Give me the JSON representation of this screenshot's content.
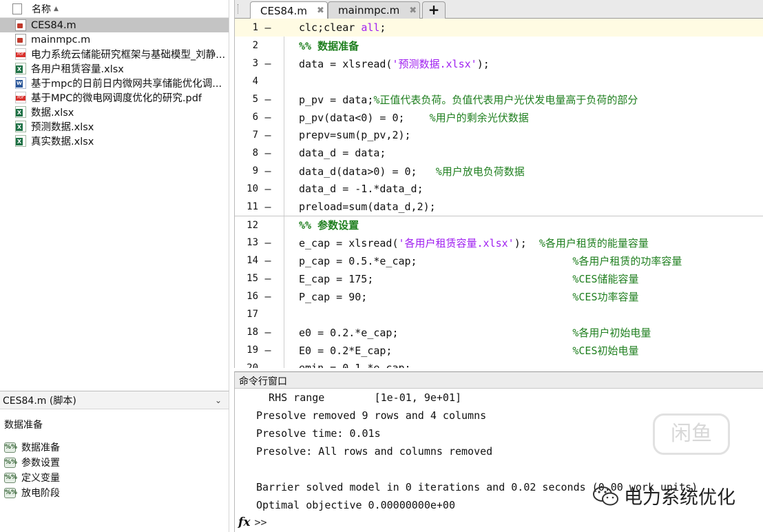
{
  "file_browser": {
    "column_header": "名称",
    "files": [
      {
        "name": "CES84.m",
        "type": "m",
        "selected": true
      },
      {
        "name": "mainmpc.m",
        "type": "m",
        "selected": false
      },
      {
        "name": "电力系统云储能研究框架与基础模型_刘静...",
        "type": "pdf",
        "selected": false
      },
      {
        "name": "各用户租赁容量.xlsx",
        "type": "xlsx",
        "selected": false
      },
      {
        "name": "基于mpc的日前日内微网共享储能优化调...",
        "type": "docx",
        "selected": false
      },
      {
        "name": "基于MPC的微电网调度优化的研究.pdf",
        "type": "pdf",
        "selected": false
      },
      {
        "name": "数据.xlsx",
        "type": "xlsx",
        "selected": false
      },
      {
        "name": "预测数据.xlsx",
        "type": "xlsx",
        "selected": false
      },
      {
        "name": "真实数据.xlsx",
        "type": "xlsx",
        "selected": false
      }
    ]
  },
  "details": {
    "header": "CES84.m (脚本)",
    "title": "数据准备",
    "sections": [
      "数据准备",
      "参数设置",
      "定义变量",
      "放电阶段"
    ],
    "section_icon": "%%"
  },
  "editor": {
    "tabs": [
      {
        "label": "CES84.m",
        "active": true
      },
      {
        "label": "mainmpc.m",
        "active": false
      }
    ],
    "add_tab_label": "+",
    "lines": [
      {
        "n": "1",
        "dash": "—",
        "parts": [
          {
            "t": "clc;clear ",
            "c": ""
          },
          {
            "t": "all",
            "c": "str"
          },
          {
            "t": ";",
            "c": ""
          }
        ],
        "hl": true
      },
      {
        "n": "2",
        "dash": "",
        "parts": [
          {
            "t": "%% 数据准备",
            "c": "sec"
          }
        ]
      },
      {
        "n": "3",
        "dash": "—",
        "parts": [
          {
            "t": "data = xlsread(",
            "c": ""
          },
          {
            "t": "'预测数据.xlsx'",
            "c": "str"
          },
          {
            "t": ");",
            "c": ""
          }
        ]
      },
      {
        "n": "4",
        "dash": "",
        "parts": []
      },
      {
        "n": "5",
        "dash": "—",
        "parts": [
          {
            "t": "p_pv = data;",
            "c": ""
          },
          {
            "t": "%正值代表负荷。负值代表用户光伏发电量高于负荷的部分",
            "c": "cmt"
          }
        ]
      },
      {
        "n": "6",
        "dash": "—",
        "parts": [
          {
            "t": "p_pv(data<0) = 0;    ",
            "c": ""
          },
          {
            "t": "%用户的剩余光伏数据",
            "c": "cmt"
          }
        ]
      },
      {
        "n": "7",
        "dash": "—",
        "parts": [
          {
            "t": "prepv=sum(p_pv,2);",
            "c": ""
          }
        ]
      },
      {
        "n": "8",
        "dash": "—",
        "parts": [
          {
            "t": "data_d = data;",
            "c": ""
          }
        ]
      },
      {
        "n": "9",
        "dash": "—",
        "parts": [
          {
            "t": "data_d(data>0) = 0;   ",
            "c": ""
          },
          {
            "t": "%用户放电负荷数据",
            "c": "cmt"
          }
        ]
      },
      {
        "n": "10",
        "dash": "—",
        "parts": [
          {
            "t": "data_d = -1.*data_d;",
            "c": ""
          }
        ]
      },
      {
        "n": "11",
        "dash": "—",
        "parts": [
          {
            "t": "preload=sum(data_d,2);",
            "c": ""
          }
        ]
      },
      {
        "n": "12",
        "dash": "",
        "parts": [
          {
            "t": "%% 参数设置",
            "c": "sec"
          }
        ],
        "section_start": true
      },
      {
        "n": "13",
        "dash": "—",
        "parts": [
          {
            "t": "e_cap = xlsread(",
            "c": ""
          },
          {
            "t": "'各用户租赁容量.xlsx'",
            "c": "str"
          },
          {
            "t": ");  ",
            "c": ""
          },
          {
            "t": "%各用户租赁的能量容量",
            "c": "cmt"
          }
        ]
      },
      {
        "n": "14",
        "dash": "—",
        "parts": [
          {
            "t": "p_cap = 0.5.*e_cap;                         ",
            "c": ""
          },
          {
            "t": "%各用户租赁的功率容量",
            "c": "cmt"
          }
        ]
      },
      {
        "n": "15",
        "dash": "—",
        "parts": [
          {
            "t": "E_cap = 175;                                ",
            "c": ""
          },
          {
            "t": "%CES储能容量",
            "c": "cmt"
          }
        ]
      },
      {
        "n": "16",
        "dash": "—",
        "parts": [
          {
            "t": "P_cap = 90;                                 ",
            "c": ""
          },
          {
            "t": "%CES功率容量",
            "c": "cmt"
          }
        ]
      },
      {
        "n": "17",
        "dash": "",
        "parts": []
      },
      {
        "n": "18",
        "dash": "—",
        "parts": [
          {
            "t": "e0 = 0.2.*e_cap;                            ",
            "c": ""
          },
          {
            "t": "%各用户初始电量",
            "c": "cmt"
          }
        ]
      },
      {
        "n": "19",
        "dash": "—",
        "parts": [
          {
            "t": "E0 = 0.2*E_cap;                             ",
            "c": ""
          },
          {
            "t": "%CES初始电量",
            "c": "cmt"
          }
        ]
      },
      {
        "n": "20",
        "dash": "—",
        "parts": [
          {
            "t": "emin = 0.1.*e_cap;",
            "c": ""
          }
        ]
      }
    ]
  },
  "command_window": {
    "title": "命令行窗口",
    "output": [
      "  RHS range        [1e-01, 9e+01]",
      "Presolve removed 9 rows and 4 columns",
      "Presolve time: 0.01s",
      "Presolve: All rows and columns removed",
      "",
      "Barrier solved model in 0 iterations and 0.02 seconds (0.00 work units)",
      "Optimal objective 0.00000000e+00"
    ],
    "fx_label": "fx",
    "prompt": ">>"
  },
  "watermark": {
    "text": "电力系统优化",
    "logo_text": "闲鱼"
  }
}
